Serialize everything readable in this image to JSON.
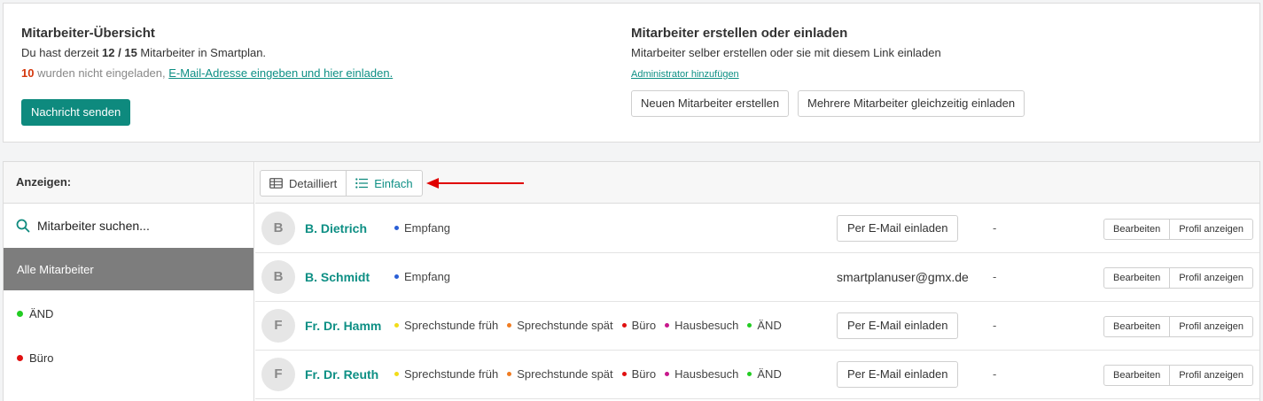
{
  "overview": {
    "title": "Mitarbeiter-Übersicht",
    "count_prefix": "Du hast derzeit ",
    "count_value": "12 / 15",
    "count_suffix": " Mitarbeiter in Smartplan.",
    "not_invited_count": "10",
    "not_invited_text": " wurden nicht eingeladen, ",
    "not_invited_link": "E-Mail-Adresse eingeben und hier einladen.",
    "send_message_label": "Nachricht senden"
  },
  "invite": {
    "title": "Mitarbeiter erstellen oder einladen",
    "subtitle": "Mitarbeiter selber erstellen oder sie mit diesem Link einladen",
    "admin_link": "Administrator hinzufügen",
    "create_label": "Neuen Mitarbeiter erstellen",
    "bulk_label": "Mehrere Mitarbeiter gleichzeitig einladen"
  },
  "sidebar": {
    "header": "Anzeigen:",
    "search_placeholder": "Mitarbeiter suchen...",
    "items": [
      {
        "label": "Alle Mitarbeiter",
        "active": true,
        "color": ""
      },
      {
        "label": "ÄND",
        "active": false,
        "color": "#22cc22"
      },
      {
        "label": "Büro",
        "active": false,
        "color": "#e01010"
      }
    ]
  },
  "view_toggle": {
    "detailed_label": "Detailliert",
    "simple_label": "Einfach",
    "active": "simple",
    "arrow_color": "#e00000"
  },
  "colors": {
    "accent": "#0e8a7e",
    "Empfang": "#2a5fd6",
    "Sprechstunde früh": "#f2dc18",
    "Sprechstunde spät": "#f07c22",
    "Büro": "#e01010",
    "Hausbesuch": "#c8188c",
    "ÄND": "#22cc22"
  },
  "employees": [
    {
      "initial": "B",
      "name": "B. Dietrich",
      "groups": [
        "Empfang"
      ],
      "invite_label": "Per E-Mail einladen",
      "email": "",
      "extra": "-",
      "edit_label": "Bearbeiten",
      "profile_label": "Profil anzeigen"
    },
    {
      "initial": "B",
      "name": "B. Schmidt",
      "groups": [
        "Empfang"
      ],
      "invite_label": "",
      "email": "smartplanuser@gmx.de",
      "extra": "-",
      "edit_label": "Bearbeiten",
      "profile_label": "Profil anzeigen"
    },
    {
      "initial": "F",
      "name": "Fr. Dr. Hamm",
      "groups": [
        "Sprechstunde früh",
        "Sprechstunde spät",
        "Büro",
        "Hausbesuch",
        "ÄND"
      ],
      "invite_label": "Per E-Mail einladen",
      "email": "",
      "extra": "-",
      "edit_label": "Bearbeiten",
      "profile_label": "Profil anzeigen"
    },
    {
      "initial": "F",
      "name": "Fr. Dr. Reuth",
      "groups": [
        "Sprechstunde früh",
        "Sprechstunde spät",
        "Büro",
        "Hausbesuch",
        "ÄND"
      ],
      "invite_label": "Per E-Mail einladen",
      "email": "",
      "extra": "-",
      "edit_label": "Bearbeiten",
      "profile_label": "Profil anzeigen"
    }
  ]
}
